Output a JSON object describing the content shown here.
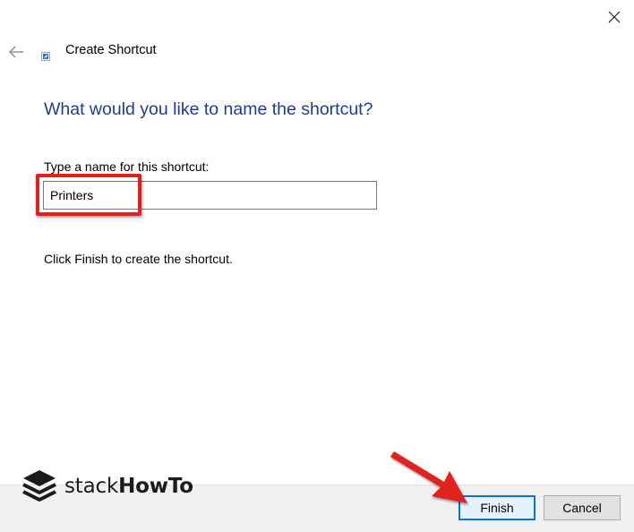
{
  "window": {
    "close_icon": "close-icon"
  },
  "wizard": {
    "back_icon": "back-arrow-icon",
    "app_icon": "shortcut-icon",
    "title": "Create Shortcut"
  },
  "main": {
    "heading": "What would you like to name the shortcut?",
    "field_label": "Type a name for this shortcut:",
    "name_value": "Printers",
    "hint": "Click Finish to create the shortcut."
  },
  "footer": {
    "finish_label": "Finish",
    "cancel_label": "Cancel"
  },
  "watermark": {
    "brand_light": "stack",
    "brand_bold": "HowTo"
  },
  "annotations": {
    "highlight_color": "#e2201c",
    "arrow_color": "#e2201c"
  },
  "colors": {
    "heading": "#1a3d97",
    "footer_bg": "#f0f0f0",
    "default_button_border": "#0078d7"
  }
}
